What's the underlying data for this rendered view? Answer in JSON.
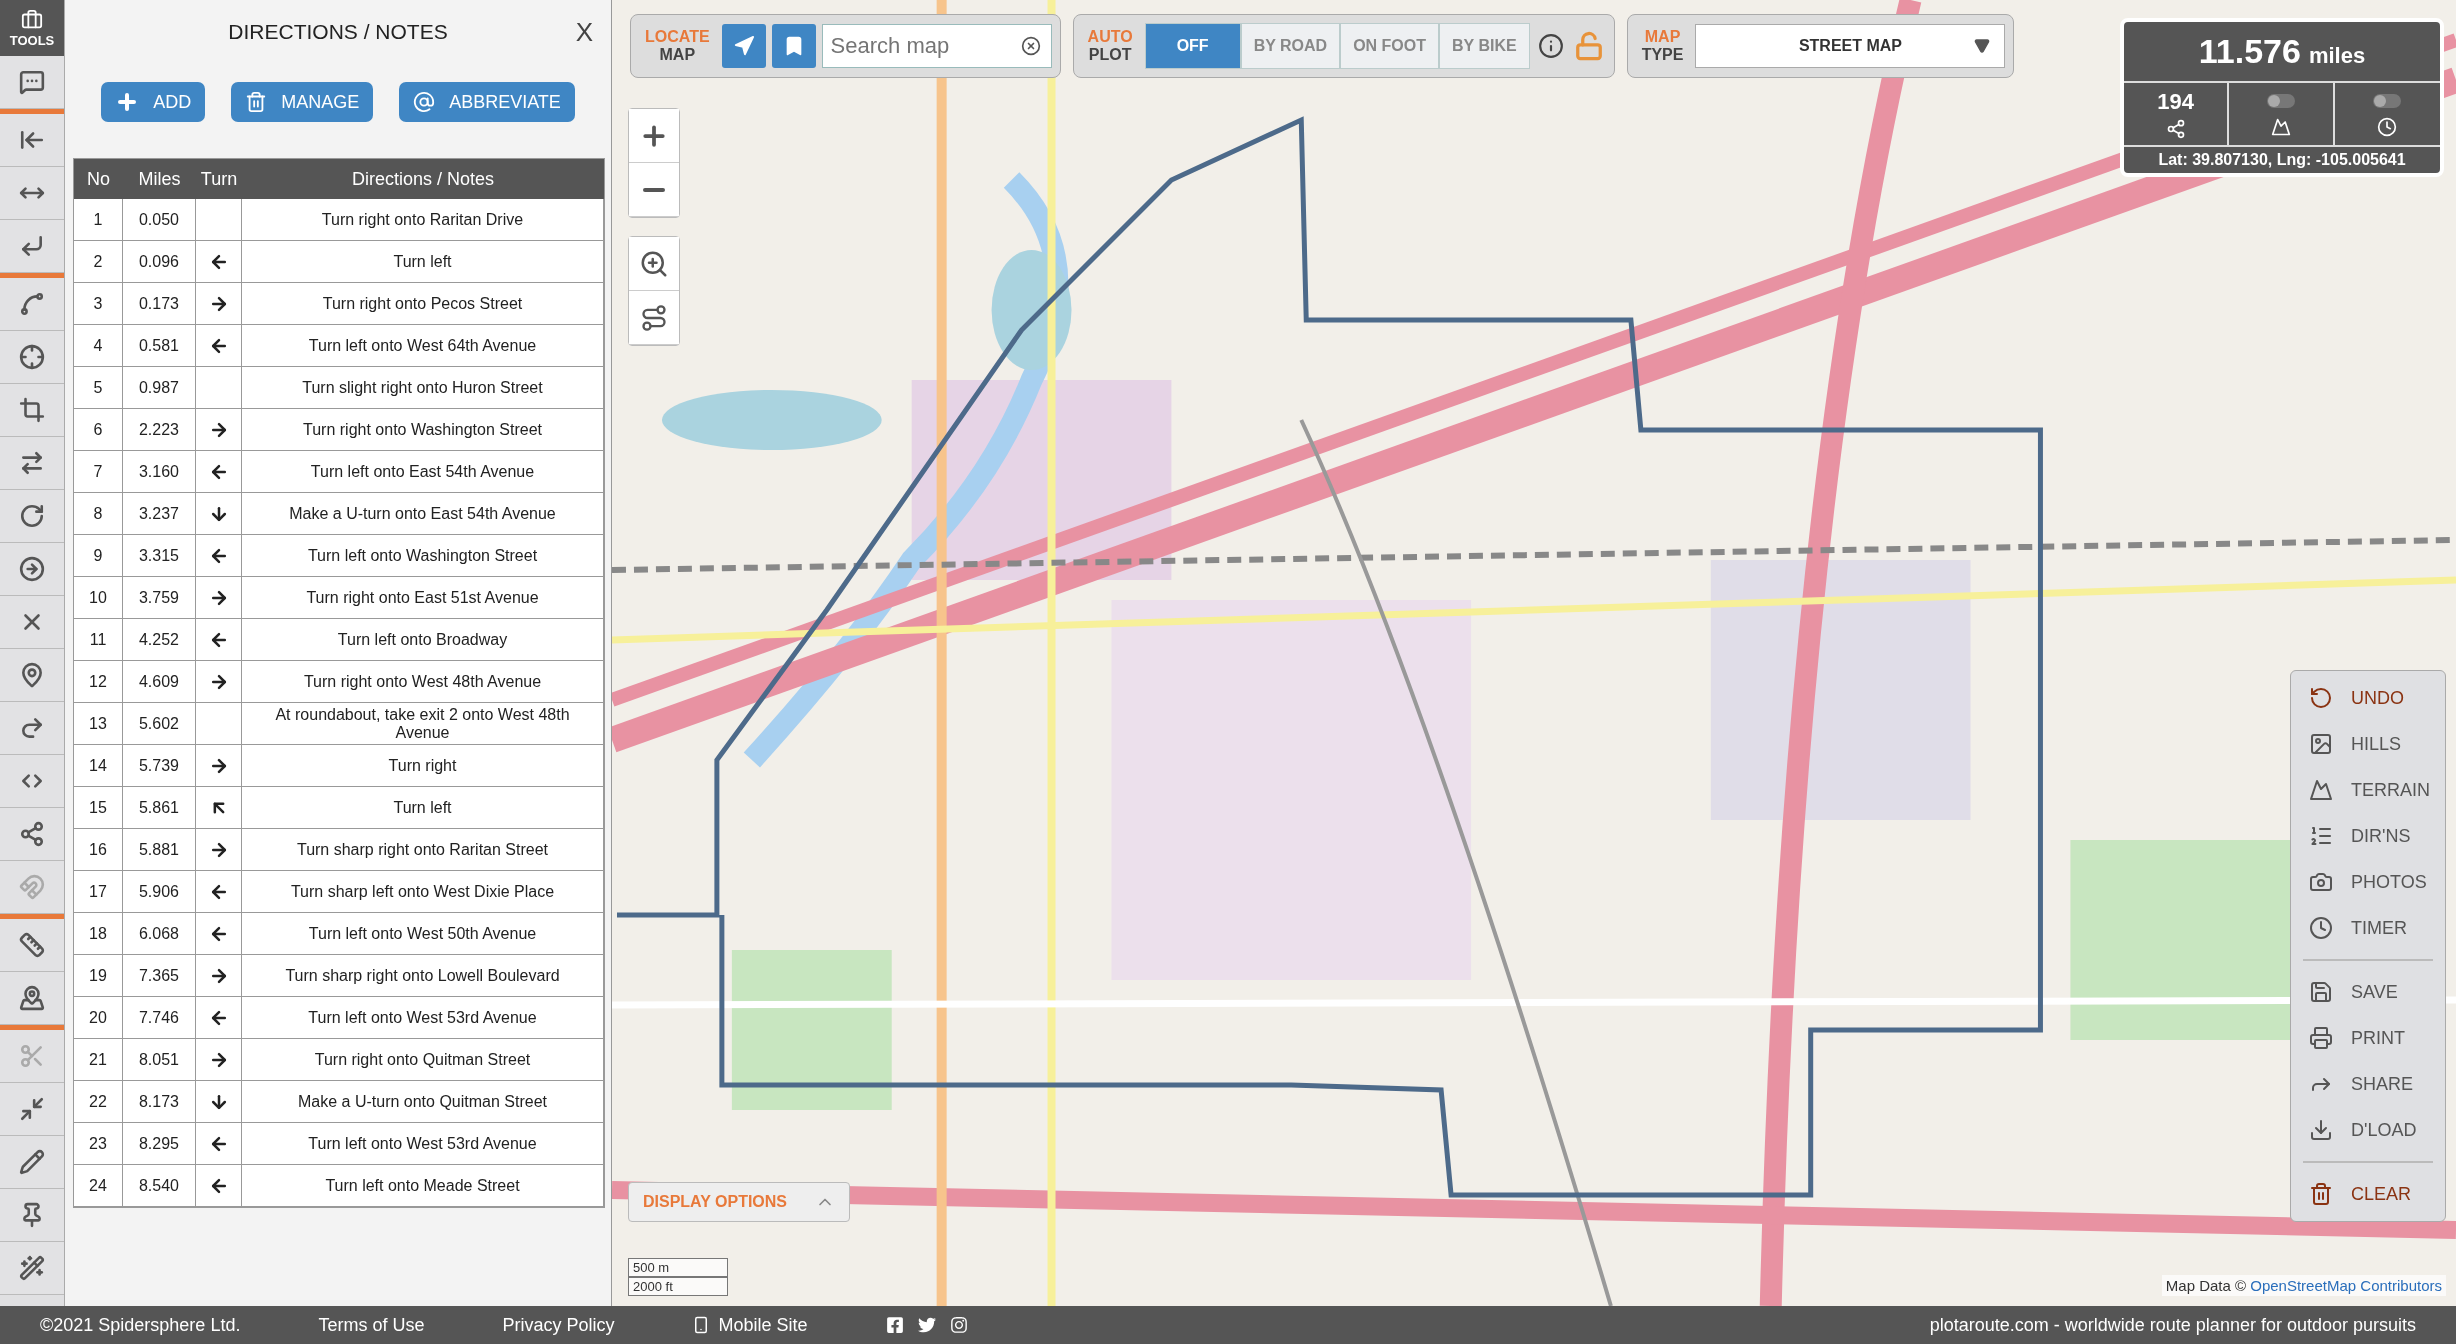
{
  "tools_header": {
    "label": "TOOLS"
  },
  "tools": [
    {
      "disabled": false
    },
    {
      "disabled": false
    },
    {
      "disabled": false
    },
    {
      "disabled": false
    },
    {
      "disabled": false
    },
    {
      "disabled": false
    },
    {
      "disabled": false
    },
    {
      "disabled": false
    },
    {
      "disabled": false
    },
    {
      "disabled": false
    },
    {
      "disabled": false
    },
    {
      "disabled": false
    },
    {
      "disabled": false
    },
    {
      "disabled": false
    },
    {
      "disabled": false
    },
    {
      "disabled": true
    },
    {
      "disabled": false
    },
    {
      "disabled": false
    },
    {
      "disabled": true
    },
    {
      "disabled": false
    },
    {
      "disabled": false
    },
    {
      "disabled": false
    },
    {
      "disabled": false
    }
  ],
  "panel": {
    "title": "DIRECTIONS / NOTES",
    "close": "X",
    "buttons": [
      {
        "label": "ADD",
        "kind": "add"
      },
      {
        "label": "MANAGE",
        "kind": "manage"
      },
      {
        "label": "ABBREVIATE",
        "kind": "abbreviate"
      }
    ]
  },
  "table": {
    "columns": [
      "No",
      "Miles",
      "Turn",
      "Directions / Notes"
    ],
    "rows": [
      {
        "no": "1",
        "miles": "0.050",
        "kind": "none",
        "text": "Turn right onto Raritan Drive"
      },
      {
        "no": "2",
        "miles": "0.096",
        "kind": "left",
        "text": "Turn left"
      },
      {
        "no": "3",
        "miles": "0.173",
        "kind": "right",
        "text": "Turn right onto Pecos Street"
      },
      {
        "no": "4",
        "miles": "0.581",
        "kind": "left",
        "text": "Turn left onto West 64th Avenue"
      },
      {
        "no": "5",
        "miles": "0.987",
        "kind": "none",
        "text": "Turn slight right onto Huron Street"
      },
      {
        "no": "6",
        "miles": "2.223",
        "kind": "right",
        "text": "Turn right onto Washington Street"
      },
      {
        "no": "7",
        "miles": "3.160",
        "kind": "left",
        "text": "Turn left onto East 54th Avenue"
      },
      {
        "no": "8",
        "miles": "3.237",
        "kind": "uturn",
        "text": "Make a U-turn onto East 54th Avenue"
      },
      {
        "no": "9",
        "miles": "3.315",
        "kind": "left",
        "text": "Turn left onto Washington Street"
      },
      {
        "no": "10",
        "miles": "3.759",
        "kind": "right",
        "text": "Turn right onto East 51st Avenue"
      },
      {
        "no": "11",
        "miles": "4.252",
        "kind": "left",
        "text": "Turn left onto Broadway"
      },
      {
        "no": "12",
        "miles": "4.609",
        "kind": "right",
        "text": "Turn right onto West 48th Avenue"
      },
      {
        "no": "13",
        "miles": "5.602",
        "kind": "none",
        "text": "At roundabout, take exit 2 onto West 48th Avenue"
      },
      {
        "no": "14",
        "miles": "5.739",
        "kind": "right",
        "text": "Turn right"
      },
      {
        "no": "15",
        "miles": "5.861",
        "kind": "sharp-left",
        "text": "Turn left"
      },
      {
        "no": "16",
        "miles": "5.881",
        "kind": "right",
        "text": "Turn sharp right onto Raritan Street"
      },
      {
        "no": "17",
        "miles": "5.906",
        "kind": "left",
        "text": "Turn sharp left onto West Dixie Place"
      },
      {
        "no": "18",
        "miles": "6.068",
        "kind": "left",
        "text": "Turn left onto West 50th Avenue"
      },
      {
        "no": "19",
        "miles": "7.365",
        "kind": "right",
        "text": "Turn sharp right onto Lowell Boulevard"
      },
      {
        "no": "20",
        "miles": "7.746",
        "kind": "left",
        "text": "Turn left onto West 53rd Avenue"
      },
      {
        "no": "21",
        "miles": "8.051",
        "kind": "right",
        "text": "Turn right onto Quitman Street"
      },
      {
        "no": "22",
        "miles": "8.173",
        "kind": "uturn",
        "text": "Make a U-turn onto Quitman Street"
      },
      {
        "no": "23",
        "miles": "8.295",
        "kind": "left",
        "text": "Turn left onto West 53rd Avenue"
      },
      {
        "no": "24",
        "miles": "8.540",
        "kind": "left",
        "text": "Turn left onto Meade Street"
      }
    ]
  },
  "locate": {
    "label_top": "LOCATE",
    "label_bottom": "MAP",
    "search": {
      "placeholder": "Search map"
    }
  },
  "autoplot": {
    "label_top": "AUTO",
    "label_bottom": "PLOT",
    "options": [
      {
        "label": "OFF",
        "selected": true
      },
      {
        "label": "BY ROAD",
        "selected": false
      },
      {
        "label": "ON FOOT",
        "selected": false
      },
      {
        "label": "BY BIKE",
        "selected": false
      }
    ],
    "locked": false
  },
  "map_type": {
    "label_top": "MAP",
    "label_bottom": "TYPE",
    "value": "STREET MAP"
  },
  "stats": {
    "distance": "11.576",
    "unit": "miles",
    "points": "194",
    "elevation_on": false,
    "timer_on": false,
    "coords": "Lat: 39.807130, Lng: -105.005641"
  },
  "display_options": {
    "label": "DISPLAY OPTIONS",
    "expanded": false
  },
  "scale": {
    "metric": "500 m",
    "imperial": "2000 ft"
  },
  "attribution": {
    "text": "Map Data ©",
    "link": "OpenStreetMap Contributors"
  },
  "menu": [
    [
      {
        "label": "UNDO",
        "kind": "undo",
        "color": "#8a3312"
      },
      {
        "label": "HILLS",
        "kind": "hills",
        "color": "#555555"
      },
      {
        "label": "TERRAIN",
        "kind": "terrain",
        "color": "#555555"
      },
      {
        "label": "DIR'NS",
        "kind": "directions",
        "color": "#555555"
      },
      {
        "label": "PHOTOS",
        "kind": "photos",
        "color": "#555555"
      },
      {
        "label": "TIMER",
        "kind": "timer",
        "color": "#555555"
      }
    ],
    [
      {
        "label": "SAVE",
        "kind": "save",
        "color": "#555555"
      },
      {
        "label": "PRINT",
        "kind": "print",
        "color": "#555555"
      },
      {
        "label": "SHARE",
        "kind": "share",
        "color": "#555555"
      },
      {
        "label": "D'LOAD",
        "kind": "download",
        "color": "#555555"
      }
    ],
    [
      {
        "label": "CLEAR",
        "kind": "clear",
        "color": "#8a3312"
      }
    ]
  ],
  "footer": {
    "copyright": "©2021 Spidersphere Ltd.",
    "links": [
      "Terms of Use",
      "Privacy Policy"
    ],
    "mobile": "Mobile Site",
    "tagline": "plotaroute.com - worldwide route planner for outdoor pursuits"
  }
}
